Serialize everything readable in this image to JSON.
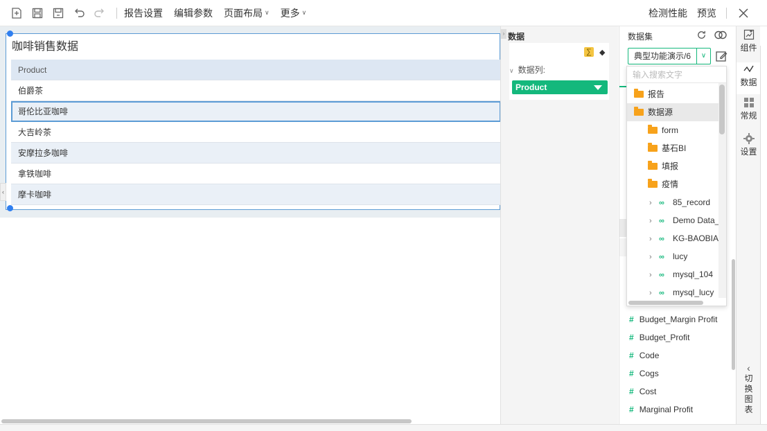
{
  "toolbar": {
    "menus": [
      {
        "label": "报告设置",
        "caret": false
      },
      {
        "label": "编辑参数",
        "caret": false
      },
      {
        "label": "页面布局",
        "caret": true
      },
      {
        "label": "更多",
        "caret": true
      }
    ],
    "check_label": "检测性能",
    "preview_label": "预览"
  },
  "report": {
    "title": "咖啡销售数据",
    "header": "Product",
    "rows": [
      "伯爵茶",
      "哥伦比亚咖啡",
      "大吉岭茶",
      "安摩拉多咖啡",
      "拿铁咖啡",
      "摩卡咖啡"
    ]
  },
  "data_panel": {
    "header": "数据",
    "sigma": "∑",
    "column_label": "数据列:",
    "field": "Product"
  },
  "dataset": {
    "title": "数据集",
    "selected": "典型功能演示/6",
    "search_placeholder": "输入搜索文字",
    "tree": [
      {
        "label": "报告",
        "type": "folder",
        "indent": 0
      },
      {
        "label": "数据源",
        "type": "folder",
        "indent": 0
      },
      {
        "label": "form",
        "type": "folder",
        "indent": 1
      },
      {
        "label": "基石BI",
        "type": "folder",
        "indent": 1
      },
      {
        "label": "填报",
        "type": "folder",
        "indent": 1
      },
      {
        "label": "疫情",
        "type": "folder",
        "indent": 1
      },
      {
        "label": "85_record",
        "type": "link",
        "indent": 1
      },
      {
        "label": "Demo Data_",
        "type": "link",
        "indent": 1
      },
      {
        "label": "KG-BAOBIA",
        "type": "link",
        "indent": 1
      },
      {
        "label": "lucy",
        "type": "link",
        "indent": 1
      },
      {
        "label": "mysql_104",
        "type": "link",
        "indent": 1
      },
      {
        "label": "mysql_lucy",
        "type": "link",
        "indent": 1
      }
    ],
    "fields": [
      "Budget_Margin Profit",
      "Budget_Profit",
      "Code",
      "Cogs",
      "Cost",
      "Marginal Profit"
    ]
  },
  "sidebar": {
    "items": [
      {
        "label": "组件",
        "icon": "component-icon"
      },
      {
        "label": "数据",
        "icon": "data-icon"
      },
      {
        "label": "常规",
        "icon": "general-icon"
      },
      {
        "label": "设置",
        "icon": "settings-icon"
      }
    ],
    "switch_label": "切换图表"
  },
  "colors": {
    "accent": "#14b87c",
    "folder": "#f7a21b",
    "selection": "#5b9bd5"
  }
}
